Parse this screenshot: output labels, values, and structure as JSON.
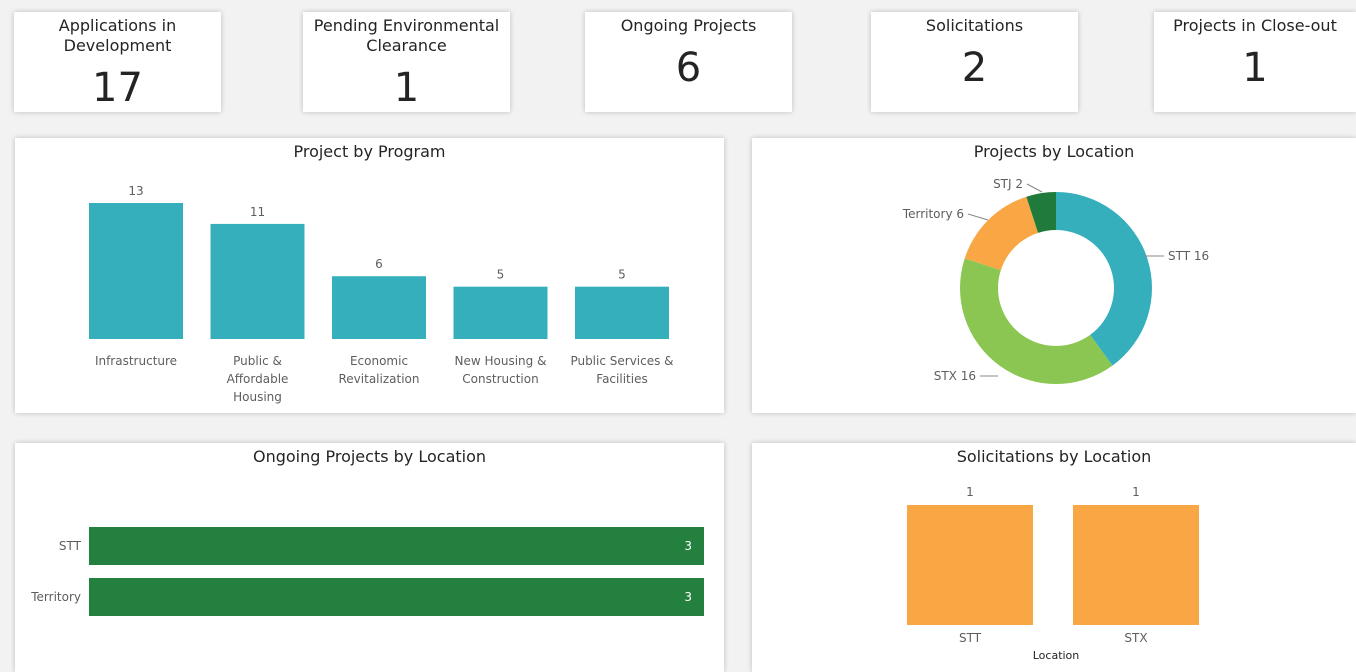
{
  "kpis": [
    {
      "title": "Applications in Development",
      "value": "17"
    },
    {
      "title": "Pending Environmental Clearance",
      "value": "1"
    },
    {
      "title": "Ongoing Projects",
      "value": "6"
    },
    {
      "title": "Solicitations",
      "value": "2"
    },
    {
      "title": "Projects in Close-out",
      "value": "1"
    }
  ],
  "colors": {
    "teal": "#36AFBD",
    "green": "#23803F",
    "light_green": "#8CC652",
    "orange": "#F9A745",
    "dark_green": "#1F7A3C"
  },
  "panels": {
    "program": {
      "title": "Project by Program"
    },
    "location_pie": {
      "title": "Projects by Location"
    },
    "ongoing": {
      "title": "Ongoing Projects by Location"
    },
    "solicitations": {
      "title": "Solicitations by Location"
    }
  },
  "chart_data": [
    {
      "type": "bar",
      "title": "Project by Program",
      "categories": [
        "Infrastructure",
        "Public & Affordable Housing",
        "Economic Revitalization",
        "New Housing & Construction",
        "Public Services & Facilities"
      ],
      "category_lines": [
        [
          "Infrastructure"
        ],
        [
          "Public &",
          "Affordable",
          "Housing"
        ],
        [
          "Economic",
          "Revitalization"
        ],
        [
          "New Housing &",
          "Construction"
        ],
        [
          "Public Services &",
          "Facilities"
        ]
      ],
      "values": [
        13,
        11,
        6,
        5,
        5
      ],
      "color": "#36AFBD",
      "grid": false
    },
    {
      "type": "pie",
      "title": "Projects by Location",
      "donut": true,
      "slices": [
        {
          "label": "STT",
          "value": 16,
          "color": "#36AFBD"
        },
        {
          "label": "STX",
          "value": 16,
          "color": "#8CC652"
        },
        {
          "label": "Territory",
          "value": 6,
          "color": "#F9A745"
        },
        {
          "label": "STJ",
          "value": 2,
          "color": "#1F7A3C"
        }
      ]
    },
    {
      "type": "bar",
      "orientation": "horizontal",
      "title": "Ongoing Projects by Location",
      "categories": [
        "STT",
        "Territory"
      ],
      "values": [
        3,
        3
      ],
      "color": "#23803F",
      "grid": false
    },
    {
      "type": "bar",
      "title": "Solicitations by Location",
      "categories": [
        "STT",
        "STX"
      ],
      "values": [
        1,
        1
      ],
      "xlabel": "Location",
      "color": "#F9A745",
      "grid": false
    }
  ]
}
